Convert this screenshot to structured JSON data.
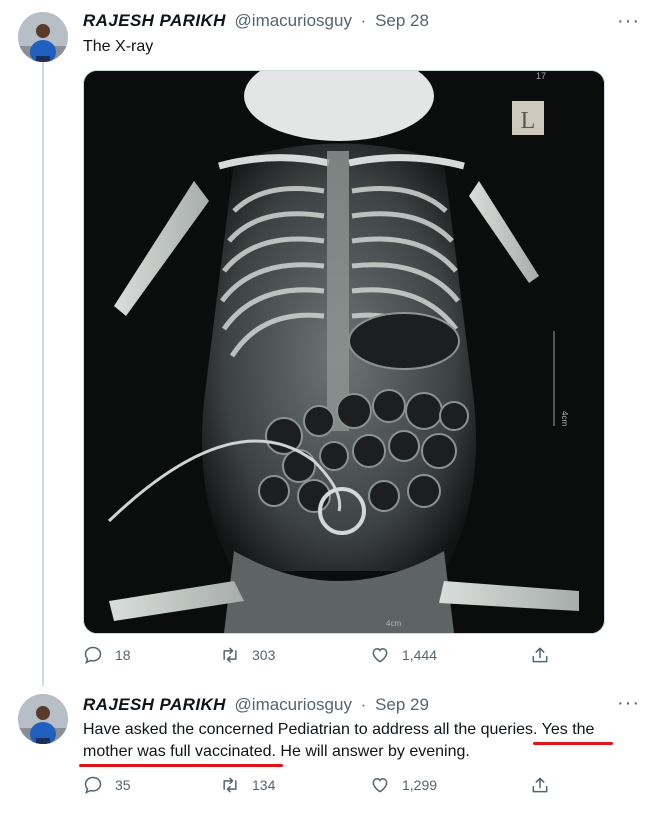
{
  "tweets": [
    {
      "author_name": "RAJESH PARIKH",
      "handle": "@imacuriosguy",
      "separator": "·",
      "date": "Sep 28",
      "text": "The X-ray",
      "media": {
        "marker_label": "L",
        "scale_label_right": "4cm",
        "scale_label_bottom": "4cm",
        "corner_label": "17"
      },
      "replies": "18",
      "retweets": "303",
      "likes": "1,444"
    },
    {
      "author_name": "RAJESH PARIKH",
      "handle": "@imacuriosguy",
      "separator": "·",
      "date": "Sep 29",
      "text": "Have asked the concerned Pediatrian to address all the queries. Yes the mother was full vaccinated. He will answer by evening.",
      "replies": "35",
      "retweets": "134",
      "likes": "1,299"
    }
  ],
  "more_label": "···",
  "colors": {
    "text": "#0f1419",
    "muted": "#536471",
    "border": "#cfd9de",
    "underline": "#e0141a"
  },
  "icons": [
    "reply-icon",
    "retweet-icon",
    "like-icon",
    "share-icon",
    "more-icon",
    "avatar"
  ]
}
